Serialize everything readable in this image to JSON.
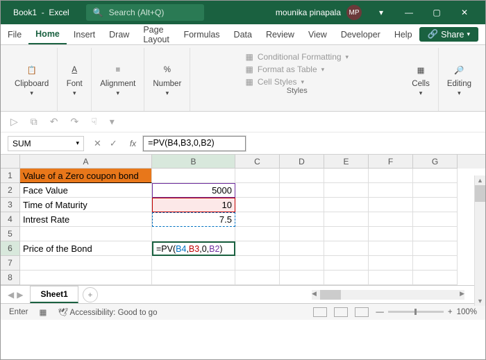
{
  "title": {
    "book": "Book1",
    "app": "Excel",
    "searchPlaceholder": "Search (Alt+Q)",
    "username": "mounika pinapala",
    "initials": "MP"
  },
  "menubar": {
    "file": "File",
    "home": "Home",
    "insert": "Insert",
    "draw": "Draw",
    "pagelayout": "Page Layout",
    "formulas": "Formulas",
    "data": "Data",
    "review": "Review",
    "view": "View",
    "developer": "Developer",
    "help": "Help",
    "share": "Share"
  },
  "ribbon": {
    "clipboard": "Clipboard",
    "font": "Font",
    "alignment": "Alignment",
    "number": "Number",
    "conditional": "Conditional Formatting",
    "formatTable": "Format as Table",
    "cellStyles": "Cell Styles",
    "styles": "Styles",
    "cells": "Cells",
    "editing": "Editing"
  },
  "formulaBar": {
    "name": "SUM",
    "formula": "=PV(B4,B3,0,B2)"
  },
  "columns": [
    "A",
    "B",
    "C",
    "D",
    "E",
    "F",
    "G"
  ],
  "cells": {
    "A1": "Value of a Zero coupon bond",
    "A2": "Face Value",
    "B2": "5000",
    "A3": "Time of Maturity",
    "B3": "10",
    "A4": "Intrest Rate",
    "B4": "7.5",
    "A6": "Price of the Bond",
    "B6_prefix": "=PV(",
    "B6_r1": "B4",
    "B6_r2": "B3",
    "B6_mid": ",0,",
    "B6_r3": "B2",
    "B6_suffix": ")"
  },
  "tabs": {
    "sheet1": "Sheet1"
  },
  "status": {
    "mode": "Enter",
    "accessibility": "Accessibility: Good to go",
    "zoom": "100%"
  }
}
